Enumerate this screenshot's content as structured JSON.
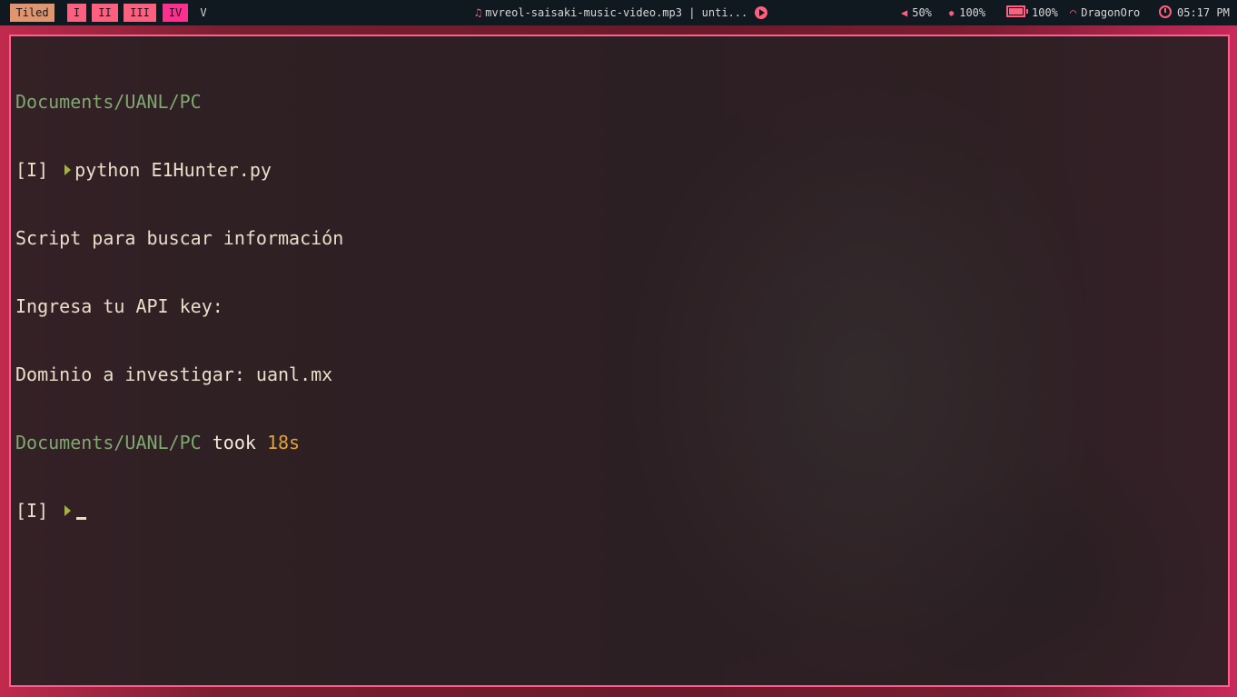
{
  "topbar": {
    "layout": "Tiled",
    "workspaces": [
      "I",
      "II",
      "III",
      "IV",
      "V"
    ],
    "media_title": "mvreol-saisaki-music-video.mp3 | unti...",
    "volume": "50%",
    "brightness": "100%",
    "battery": "100%",
    "wifi": "DragonOro",
    "time": "05:17 PM"
  },
  "terminal": {
    "lines": {
      "dir1": "Documents/UANL/PC",
      "prompt1": "[I]",
      "cmd1": "python E1Hunter.py",
      "out1": "Script para buscar información",
      "out2": "Ingresa tu API key:",
      "out3": "Dominio a investigar: uanl.mx",
      "dir2": "Documents/UANL/PC",
      "took_word": "took",
      "took_time": "18s",
      "prompt2": "[I]"
    }
  }
}
